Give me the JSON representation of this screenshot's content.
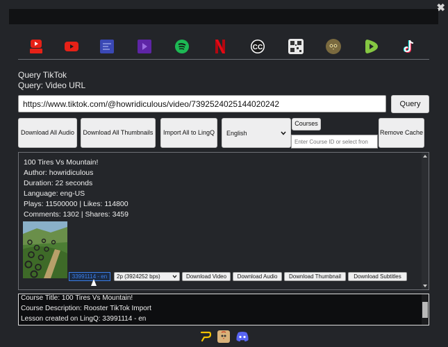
{
  "window": {
    "close_glyph": "✖"
  },
  "services": [
    {
      "icon": "youtube-logo-icon",
      "color": "#e62117"
    },
    {
      "icon": "youtube-play-icon",
      "color": "#e62117"
    },
    {
      "icon": "blue-square-icon",
      "color": "#3a48b5"
    },
    {
      "icon": "purple-square-icon",
      "color": "#6a2bb5"
    },
    {
      "icon": "spotify-icon",
      "color": "#1db954"
    },
    {
      "icon": "netflix-icon",
      "color": "#e50914"
    },
    {
      "icon": "cc-icon",
      "color": "#ffffff"
    },
    {
      "icon": "qr-icon",
      "color": "#dddddd"
    },
    {
      "icon": "owl-icon",
      "color": "#7a6a3f"
    },
    {
      "icon": "rumble-icon",
      "color": "#85c742"
    },
    {
      "icon": "tiktok-icon",
      "color": "#ffffff"
    }
  ],
  "query": {
    "line1": "Query TikTok",
    "line2": "Query: Video URL",
    "url_value": "https://www.tiktok.com/@howridiculous/video/7392524025144020242",
    "query_button": "Query"
  },
  "actions": {
    "download_all_audio": "Download All Audio",
    "download_all_thumbnails": "Download All Thumbnails",
    "import_all": "Import All to LingQ",
    "language": "English",
    "courses_button": "Courses",
    "course_placeholder": "Enter Course ID or select fron",
    "remove_cache": "Remove Cache"
  },
  "video": {
    "title": "100 Tires Vs Mountain!",
    "author": "Author: howridiculous",
    "duration": "Duration: 22 seconds",
    "language": "Language: eng-US",
    "plays_likes": "Plays: 11500000 | Likes: 114800",
    "comments_shares": "Comments: 1302 | Shares: 3459",
    "lesson_tag": "33991114 - en",
    "quality": "2p (3924252 bps)",
    "download_video": "Download Video",
    "download_audio": "Download Audio",
    "download_thumbnail": "Download Thumbnail",
    "download_subtitles": "Download Subtitles"
  },
  "log": {
    "line1": "Course Title: 100 Tires Vs Mountain!",
    "line2": "Course Description: Rooster TikTok Import",
    "line3": "Lesson created on LingQ: 33991114 - en"
  },
  "footer": [
    {
      "icon": "lingq-icon",
      "color": "#f2c200"
    },
    {
      "icon": "rooster-icon",
      "color": "#d9b27a"
    },
    {
      "icon": "discord-icon",
      "color": "#5865f2"
    }
  ]
}
